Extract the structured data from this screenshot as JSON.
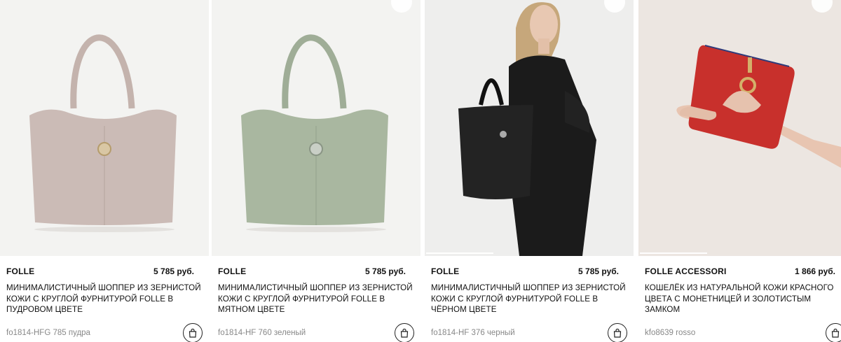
{
  "products": [
    {
      "brand": "FOLLE",
      "price": "5 785 руб.",
      "title": "МИНИМАЛИСТИЧНЫЙ ШОППЕР ИЗ ЗЕРНИСТОЙ КОЖИ С КРУГЛОЙ ФУРНИТУРОЙ FOLLE В ПУДРОВОМ ЦВЕТЕ",
      "sku": "fo1814-HFG 785 пудра",
      "image": "powder-tote-bag",
      "color": "#cbbbb6"
    },
    {
      "brand": "FOLLE",
      "price": "5 785 руб.",
      "title": "МИНИМАЛИСТИЧНЫЙ ШОППЕР ИЗ ЗЕРНИСТОЙ КОЖИ С КРУГЛОЙ ФУРНИТУРОЙ FOLLE В МЯТНОМ ЦВЕТЕ",
      "sku": "fo1814-HF 760 зеленый",
      "image": "mint-tote-bag",
      "color": "#a9b7a0"
    },
    {
      "brand": "FOLLE",
      "price": "5 785 руб.",
      "title": "МИНИМАЛИСТИЧНЫЙ ШОППЕР ИЗ ЗЕРНИСТОЙ КОЖИ С КРУГЛОЙ ФУРНИТУРОЙ FOLLE В ЧЁРНОМ ЦВЕТЕ",
      "sku": "fo1814-HF 376 черный",
      "image": "model-with-black-tote",
      "color": "#1e1e1e"
    },
    {
      "brand": "FOLLE ACCESSORI",
      "price": "1 866 руб.",
      "title": "КОШЕЛЁК ИЗ НАТУРАЛЬНОЙ КОЖИ КРАСНОГО ЦВЕТА С МОНЕТНИЦЕЙ И ЗОЛОТИСТЫМ ЗАМКОМ",
      "sku": "kfo8639 rosso",
      "image": "hand-holding-red-wallet",
      "color": "#c8302c"
    }
  ],
  "icons": {
    "cart": "shopping-bag-icon",
    "favorite": "favorite-icon"
  }
}
